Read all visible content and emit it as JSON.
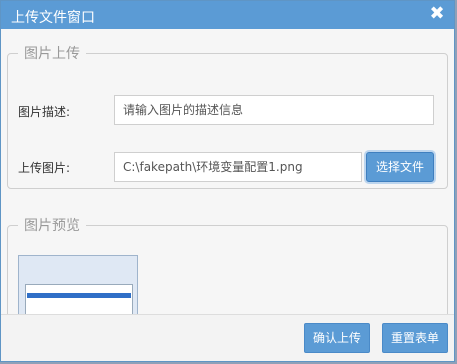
{
  "dialog": {
    "title": "上传文件窗口",
    "close_glyph": "✖"
  },
  "upload_section": {
    "legend": "图片上传",
    "description_label": "图片描述:",
    "description_placeholder": "请输入图片的描述信息",
    "file_label": "上传图片:",
    "file_value": "C:\\fakepath\\环境变量配置1.png",
    "choose_button": "选择文件"
  },
  "preview_section": {
    "legend": "图片预览"
  },
  "footer": {
    "confirm_button": "确认上传",
    "reset_button": "重置表单"
  },
  "colors": {
    "accent": "#5b9bd5"
  }
}
